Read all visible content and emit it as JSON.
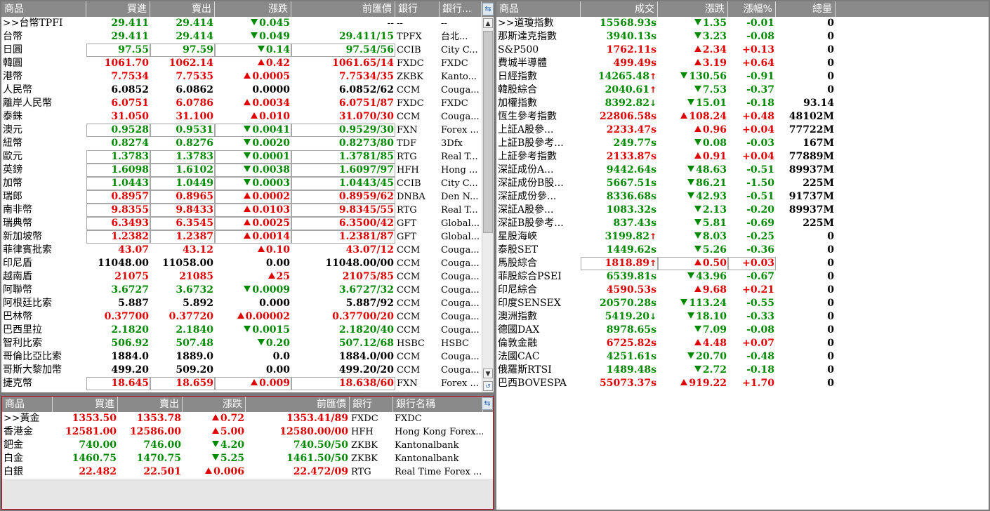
{
  "fx": {
    "headers": [
      "商品",
      "買進",
      "賣出",
      "漲跌",
      "前匯價",
      "銀行",
      "銀行..."
    ],
    "rows": [
      {
        "name": ">>台幣TPFI",
        "bid": "29.411",
        "ask": "29.414",
        "chg": "0.045",
        "dir": "dn",
        "prev": "--",
        "bank": "--",
        "bankname": "--"
      },
      {
        "name": "台幣",
        "bid": "29.411",
        "ask": "29.414",
        "chg": "0.049",
        "dir": "dn",
        "prev": "29.411/15",
        "bank": "TPFX",
        "bankname": "台北..."
      },
      {
        "name": "日圓",
        "bid": "97.55",
        "ask": "97.59",
        "chg": "0.14",
        "dir": "dn",
        "prev": "97.54/56",
        "bank": "CCIB",
        "bankname": "City C..."
      },
      {
        "name": "韓圓",
        "bid": "1061.70",
        "ask": "1062.14",
        "chg": "0.42",
        "dir": "up",
        "prev": "1061.65/14",
        "bank": "FXDC",
        "bankname": "FXDC"
      },
      {
        "name": "港幣",
        "bid": "7.7534",
        "ask": "7.7535",
        "chg": "0.0005",
        "dir": "up",
        "prev": "7.7534/35",
        "bank": "ZKBK",
        "bankname": "Kanto..."
      },
      {
        "name": "人民幣",
        "bid": "6.0852",
        "ask": "6.0862",
        "chg": "0.0000",
        "dir": "fl",
        "prev": "6.0852/62",
        "bank": "CCM",
        "bankname": "Couga..."
      },
      {
        "name": "離岸人民幣",
        "bid": "6.0751",
        "ask": "6.0786",
        "chg": "0.0034",
        "dir": "up",
        "prev": "6.0751/87",
        "bank": "FXDC",
        "bankname": "FXDC"
      },
      {
        "name": "泰銖",
        "bid": "31.050",
        "ask": "31.100",
        "chg": "0.010",
        "dir": "up",
        "prev": "31.070/30",
        "bank": "CCM",
        "bankname": "Couga..."
      },
      {
        "name": "澳元",
        "bid": "0.9528",
        "ask": "0.9531",
        "chg": "0.0041",
        "dir": "dn",
        "prev": "0.9529/30",
        "bank": "FXN",
        "bankname": "Forex ..."
      },
      {
        "name": "紐幣",
        "bid": "0.8274",
        "ask": "0.8276",
        "chg": "0.0020",
        "dir": "dn",
        "prev": "0.8273/80",
        "bank": "TDF",
        "bankname": "3Dfx"
      },
      {
        "name": "歐元",
        "bid": "1.3783",
        "ask": "1.3783",
        "chg": "0.0001",
        "dir": "dn",
        "prev": "1.3781/85",
        "bank": "RTG",
        "bankname": "Real T..."
      },
      {
        "name": "英鎊",
        "bid": "1.6098",
        "ask": "1.6102",
        "chg": "0.0038",
        "dir": "dn",
        "prev": "1.6097/97",
        "bank": "HFH",
        "bankname": "Hong ..."
      },
      {
        "name": "加幣",
        "bid": "1.0443",
        "ask": "1.0449",
        "chg": "0.0003",
        "dir": "dn",
        "prev": "1.0443/45",
        "bank": "CCIB",
        "bankname": "City C..."
      },
      {
        "name": "瑞郎",
        "bid": "0.8957",
        "ask": "0.8965",
        "chg": "0.0002",
        "dir": "up",
        "prev": "0.8959/62",
        "bank": "DNBA",
        "bankname": "Den N..."
      },
      {
        "name": "南非幣",
        "bid": "9.8355",
        "ask": "9.8433",
        "chg": "0.0103",
        "dir": "up",
        "prev": "9.8345/55",
        "bank": "RTG",
        "bankname": "Real T..."
      },
      {
        "name": "瑞典幣",
        "bid": "6.3493",
        "ask": "6.3545",
        "chg": "0.0025",
        "dir": "up",
        "prev": "6.3500/42",
        "bank": "GFT",
        "bankname": "Global..."
      },
      {
        "name": "新加坡幣",
        "bid": "1.2382",
        "ask": "1.2387",
        "chg": "0.0014",
        "dir": "up",
        "prev": "1.2381/87",
        "bank": "GFT",
        "bankname": "Global..."
      },
      {
        "name": "菲律賓批索",
        "bid": "43.07",
        "ask": "43.12",
        "chg": "0.10",
        "dir": "up",
        "prev": "43.07/12",
        "bank": "CCM",
        "bankname": "Couga..."
      },
      {
        "name": "印尼盾",
        "bid": "11048.00",
        "ask": "11058.00",
        "chg": "0.00",
        "dir": "fl",
        "prev": "11048.00/00",
        "bank": "CCM",
        "bankname": "Couga..."
      },
      {
        "name": "越南盾",
        "bid": "21075",
        "ask": "21085",
        "chg": "25",
        "dir": "up",
        "prev": "21075/85",
        "bank": "CCM",
        "bankname": "Couga..."
      },
      {
        "name": "阿聯幣",
        "bid": "3.6727",
        "ask": "3.6732",
        "chg": "0.0009",
        "dir": "dn",
        "prev": "3.6727/32",
        "bank": "CCM",
        "bankname": "Couga..."
      },
      {
        "name": "阿根廷比索",
        "bid": "5.887",
        "ask": "5.892",
        "chg": "0.000",
        "dir": "fl",
        "prev": "5.887/92",
        "bank": "CCM",
        "bankname": "Couga..."
      },
      {
        "name": "巴林幣",
        "bid": "0.37700",
        "ask": "0.37720",
        "chg": "0.00002",
        "dir": "up",
        "prev": "0.37700/20",
        "bank": "CCM",
        "bankname": "Couga..."
      },
      {
        "name": "巴西里拉",
        "bid": "2.1820",
        "ask": "2.1840",
        "chg": "0.0015",
        "dir": "dn",
        "prev": "2.1820/40",
        "bank": "CCM",
        "bankname": "Couga..."
      },
      {
        "name": "智利比索",
        "bid": "506.92",
        "ask": "507.48",
        "chg": "0.20",
        "dir": "dn",
        "prev": "507.12/68",
        "bank": "HSBC",
        "bankname": "HSBC"
      },
      {
        "name": "哥倫比亞比索",
        "bid": "1884.0",
        "ask": "1889.0",
        "chg": "0.0",
        "dir": "fl",
        "prev": "1884.0/00",
        "bank": "CCM",
        "bankname": "Couga..."
      },
      {
        "name": "哥斯大黎加幣",
        "bid": "499.20",
        "ask": "509.20",
        "chg": "0.00",
        "dir": "fl",
        "prev": "499.20/20",
        "bank": "CCM",
        "bankname": "Couga..."
      },
      {
        "name": "捷克幣",
        "bid": "18.645",
        "ask": "18.659",
        "chg": "0.009",
        "dir": "up",
        "prev": "18.638/60",
        "bank": "FXN",
        "bankname": "Forex ..."
      }
    ]
  },
  "metals": {
    "headers": [
      "商品",
      "買進",
      "賣出",
      "漲跌",
      "前匯價",
      "銀行",
      "銀行名稱"
    ],
    "rows": [
      {
        "name": ">>黃金",
        "bid": "1353.50",
        "ask": "1353.78",
        "chg": "0.72",
        "dir": "up",
        "prev": "1353.41/89",
        "bank": "FXDC",
        "bankname": "FXDC"
      },
      {
        "name": "香港金",
        "bid": "12581.00",
        "ask": "12586.00",
        "chg": "5.00",
        "dir": "up",
        "prev": "12580.00/00",
        "bank": "HFH",
        "bankname": "Hong Kong Forex..."
      },
      {
        "name": "鈀金",
        "bid": "740.00",
        "ask": "746.00",
        "chg": "4.20",
        "dir": "dn",
        "prev": "740.50/50",
        "bank": "ZKBK",
        "bankname": "Kantonalbank"
      },
      {
        "name": "白金",
        "bid": "1460.75",
        "ask": "1470.75",
        "chg": "5.25",
        "dir": "dn",
        "prev": "1461.50/50",
        "bank": "ZKBK",
        "bankname": "Kantonalbank"
      },
      {
        "name": "白銀",
        "bid": "22.482",
        "ask": "22.501",
        "chg": "0.006",
        "dir": "up",
        "prev": "22.472/09",
        "bank": "RTG",
        "bankname": "Real Time Forex ..."
      }
    ]
  },
  "indices": {
    "headers": [
      "商品",
      "成交",
      "漲跌",
      "漲幅%",
      "總量"
    ],
    "rows": [
      {
        "name": ">>道瓊指數",
        "price": "15568.93s",
        "pdir": "dn",
        "flag": "",
        "chg": "1.35",
        "dir": "dn",
        "pct": "-0.01",
        "vol": "0"
      },
      {
        "name": "那斯達克指數",
        "price": "3940.13s",
        "pdir": "dn",
        "flag": "",
        "chg": "3.23",
        "dir": "dn",
        "pct": "-0.08",
        "vol": "0"
      },
      {
        "name": "S&P500",
        "price": "1762.11s",
        "pdir": "up",
        "flag": "",
        "chg": "2.34",
        "dir": "up",
        "pct": "+0.13",
        "vol": "0"
      },
      {
        "name": "費城半導體",
        "price": "499.49s",
        "pdir": "up",
        "flag": "",
        "chg": "3.19",
        "dir": "up",
        "pct": "+0.64",
        "vol": "0"
      },
      {
        "name": "日經指數",
        "price": "14265.48",
        "pdir": "dn",
        "flag": "up",
        "chg": "130.56",
        "dir": "dn",
        "pct": "-0.91",
        "vol": "0"
      },
      {
        "name": "韓股綜合",
        "price": "2040.61",
        "pdir": "dn",
        "flag": "up",
        "chg": "7.53",
        "dir": "dn",
        "pct": "-0.37",
        "vol": "0"
      },
      {
        "name": "加權指數",
        "price": "8392.82",
        "pdir": "dn",
        "flag": "dn",
        "chg": "15.01",
        "dir": "dn",
        "pct": "-0.18",
        "vol": "93.14"
      },
      {
        "name": "恆生參考指數",
        "price": "22806.58s",
        "pdir": "up",
        "flag": "",
        "chg": "108.24",
        "dir": "up",
        "pct": "+0.48",
        "vol": "48102M"
      },
      {
        "name": "上証A股參...",
        "price": "2233.47s",
        "pdir": "up",
        "flag": "",
        "chg": "0.96",
        "dir": "up",
        "pct": "+0.04",
        "vol": "77722M"
      },
      {
        "name": "上証B股參考...",
        "price": "249.77s",
        "pdir": "dn",
        "flag": "",
        "chg": "0.08",
        "dir": "dn",
        "pct": "-0.03",
        "vol": "167M"
      },
      {
        "name": "上証參考指數",
        "price": "2133.87s",
        "pdir": "up",
        "flag": "",
        "chg": "0.91",
        "dir": "up",
        "pct": "+0.04",
        "vol": "77889M"
      },
      {
        "name": "深証成份A...",
        "price": "9442.64s",
        "pdir": "dn",
        "flag": "",
        "chg": "48.63",
        "dir": "dn",
        "pct": "-0.51",
        "vol": "89937M"
      },
      {
        "name": "深証成份B股...",
        "price": "5667.51s",
        "pdir": "dn",
        "flag": "",
        "chg": "86.21",
        "dir": "dn",
        "pct": "-1.50",
        "vol": "225M"
      },
      {
        "name": "深証成份參...",
        "price": "8336.68s",
        "pdir": "dn",
        "flag": "",
        "chg": "42.93",
        "dir": "dn",
        "pct": "-0.51",
        "vol": "91737M"
      },
      {
        "name": "深証A股參...",
        "price": "1083.32s",
        "pdir": "dn",
        "flag": "",
        "chg": "2.13",
        "dir": "dn",
        "pct": "-0.20",
        "vol": "89937M"
      },
      {
        "name": "深証B股參考...",
        "price": "837.43s",
        "pdir": "dn",
        "flag": "",
        "chg": "5.81",
        "dir": "dn",
        "pct": "-0.69",
        "vol": "225M"
      },
      {
        "name": "星股海峽",
        "price": "3199.82",
        "pdir": "dn",
        "flag": "up",
        "chg": "8.03",
        "dir": "dn",
        "pct": "-0.25",
        "vol": "0"
      },
      {
        "name": "泰股SET",
        "price": "1449.62s",
        "pdir": "dn",
        "flag": "",
        "chg": "5.26",
        "dir": "dn",
        "pct": "-0.36",
        "vol": "0"
      },
      {
        "name": "馬股綜合",
        "price": "1818.89",
        "pdir": "up",
        "flag": "up",
        "chg": "0.50",
        "dir": "up",
        "pct": "+0.03",
        "vol": "0",
        "box": true
      },
      {
        "name": "菲股綜合PSEI",
        "price": "6539.81s",
        "pdir": "dn",
        "flag": "",
        "chg": "43.96",
        "dir": "dn",
        "pct": "-0.67",
        "vol": "0"
      },
      {
        "name": "印尼綜合",
        "price": "4590.53s",
        "pdir": "up",
        "flag": "",
        "chg": "9.68",
        "dir": "up",
        "pct": "+0.21",
        "vol": "0"
      },
      {
        "name": "印度SENSEX",
        "price": "20570.28s",
        "pdir": "dn",
        "flag": "",
        "chg": "113.24",
        "dir": "dn",
        "pct": "-0.55",
        "vol": "0"
      },
      {
        "name": "澳洲指數",
        "price": "5419.20",
        "pdir": "dn",
        "flag": "dn",
        "chg": "18.10",
        "dir": "dn",
        "pct": "-0.33",
        "vol": "0"
      },
      {
        "name": "德國DAX",
        "price": "8978.65s",
        "pdir": "dn",
        "flag": "",
        "chg": "7.09",
        "dir": "dn",
        "pct": "-0.08",
        "vol": "0"
      },
      {
        "name": "倫敦金融",
        "price": "6725.82s",
        "pdir": "up",
        "flag": "",
        "chg": "4.48",
        "dir": "up",
        "pct": "+0.07",
        "vol": "0"
      },
      {
        "name": "法國CAC",
        "price": "4251.61s",
        "pdir": "dn",
        "flag": "",
        "chg": "20.70",
        "dir": "dn",
        "pct": "-0.48",
        "vol": "0"
      },
      {
        "name": "俄羅斯RTSI",
        "price": "1489.48s",
        "pdir": "dn",
        "flag": "",
        "chg": "2.72",
        "dir": "dn",
        "pct": "-0.18",
        "vol": "0"
      },
      {
        "name": "巴西BOVESPA",
        "price": "55073.37s",
        "pdir": "up",
        "flag": "",
        "chg": "919.22",
        "dir": "up",
        "pct": "+1.70",
        "vol": "0"
      }
    ]
  },
  "icons": {
    "scroll_up": "▲",
    "scroll_down": "▼",
    "corner": "⇆",
    "flag_up": "↑",
    "flag_dn": "↓"
  },
  "colors": {
    "up": "#e00000",
    "down": "#008a00",
    "header": "#8a8a8a"
  }
}
